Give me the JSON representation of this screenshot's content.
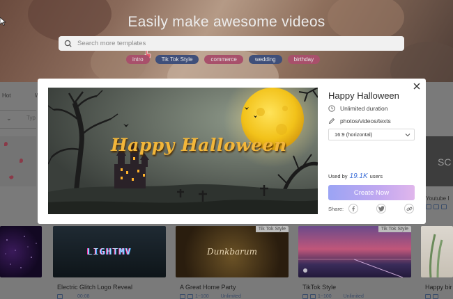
{
  "hero": {
    "title": "Easily make awesome videos",
    "search_placeholder": "Search more templates",
    "tags": [
      {
        "label": "intro",
        "color": "#a8506b"
      },
      {
        "label": "Tik Tok Style",
        "color": "#3f4f7a"
      },
      {
        "label": "commerce",
        "color": "#a8506b"
      },
      {
        "label": "wedding",
        "color": "#3f4f7a"
      },
      {
        "label": "birthday",
        "color": "#a8506b"
      }
    ]
  },
  "background": {
    "left_nav_1": "Hot",
    "left_nav_2": "W",
    "left_filter": "Typ",
    "right_card_text": "SC",
    "right_card_label": "Youtube I",
    "cards": [
      {
        "title": "",
        "badge": "",
        "meta": ""
      },
      {
        "title": "Electric Glitch Logo Reveal",
        "badge": "",
        "meta": "00:08",
        "art_text": "LIGHTMV"
      },
      {
        "title": "A Great Home Party",
        "badge": "Tik Tok Style",
        "meta": "1~100",
        "meta2": "Unlimited",
        "art_text": "Dunkbarum"
      },
      {
        "title": "TikTok Style",
        "badge": "Tik Tok Style",
        "meta": "1~100",
        "meta2": "Unlimited"
      },
      {
        "title": "Happy bir",
        "badge": "",
        "meta": ""
      }
    ]
  },
  "modal": {
    "title": "Happy Halloween",
    "duration": "Unlimited duration",
    "media_types": "photos/videos/texts",
    "aspect_selected": "16:9 (horizontal)",
    "used_by_prefix": "Used by",
    "used_by_count": "19.1K",
    "used_by_suffix": "users",
    "create_label": "Create Now",
    "share_label": "Share:",
    "preview_text": "Happy Halloween"
  },
  "colors": {
    "accent_blue": "#3d6fd8",
    "create_gradient_start": "#9ba4f4",
    "create_gradient_end": "#e0b6ec",
    "moon": "#f2c21a"
  }
}
